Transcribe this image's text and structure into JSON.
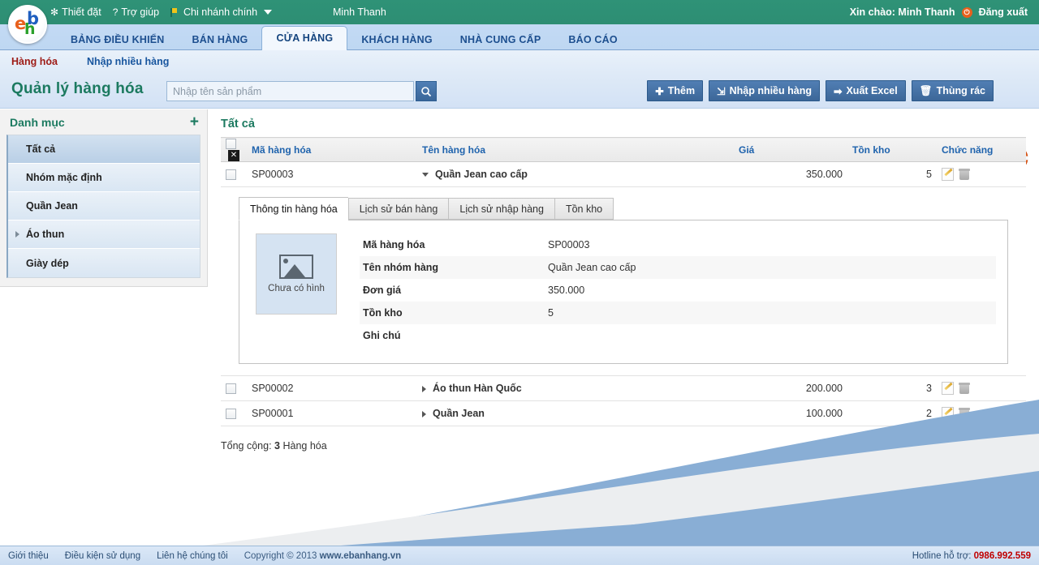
{
  "topbar": {
    "settings": "Thiết đặt",
    "settings_glyph": "✻",
    "help": "Trợ giúp",
    "help_glyph": "?",
    "branch": "Chi nhánh chính",
    "user_mid": "Minh Thanh",
    "greeting": "Xin chào: Minh Thanh",
    "logout": "Đăng xuất",
    "power_glyph": "⏻"
  },
  "logo": {
    "e": "e",
    "b": "b",
    "h": "h"
  },
  "nav": {
    "tabs": [
      {
        "label": "BẢNG ĐIỀU KHIỂN",
        "active": false
      },
      {
        "label": "BÁN HÀNG",
        "active": false
      },
      {
        "label": "CỬA HÀNG",
        "active": true
      },
      {
        "label": "KHÁCH HÀNG",
        "active": false
      },
      {
        "label": "NHÀ CUNG CẤP",
        "active": false
      },
      {
        "label": "BÁO CÁO",
        "active": false
      }
    ]
  },
  "subnav": {
    "items": [
      {
        "label": "Hàng hóa",
        "current": true
      },
      {
        "label": "Nhập nhiều hàng",
        "current": false
      }
    ]
  },
  "pagebar": {
    "title": "Quản lý hàng hóa",
    "search_placeholder": "Nhập tên sản phẩm",
    "search_value": "",
    "buttons": [
      {
        "icon": "✚",
        "label": "Thêm"
      },
      {
        "icon": "⇲",
        "label": "Nhập nhiều hàng"
      },
      {
        "icon": "➡",
        "label": "Xuất Excel"
      },
      {
        "icon": "🗑",
        "label": "Thùng rác"
      }
    ]
  },
  "sidebar": {
    "title": "Danh mục",
    "add_glyph": "+",
    "items": [
      {
        "label": "Tất cả",
        "active": true,
        "arrow": false
      },
      {
        "label": "Nhóm mặc định",
        "active": false,
        "arrow": false
      },
      {
        "label": "Quần Jean",
        "active": false,
        "arrow": false
      },
      {
        "label": "Áo thun",
        "active": false,
        "arrow": true
      },
      {
        "label": "Giày dép",
        "active": false,
        "arrow": false
      }
    ]
  },
  "main": {
    "heading": "Tất cả",
    "columns": {
      "code": "Mã hàng hóa",
      "name": "Tên hàng hóa",
      "price": "Giá",
      "stock": "Tồn kho",
      "fn": "Chức năng"
    },
    "rows": [
      {
        "code": "SP00003",
        "name": "Quần Jean cao cấp",
        "price": "350.000",
        "stock": "5",
        "expanded": true
      },
      {
        "code": "SP00002",
        "name": "Áo thun Hàn Quốc",
        "price": "200.000",
        "stock": "3",
        "expanded": false
      },
      {
        "code": "SP00001",
        "name": "Quần Jean",
        "price": "100.000",
        "stock": "2",
        "expanded": false
      }
    ],
    "total_label": "Tổng cộng:",
    "total_count": "3",
    "total_unit": "Hàng hóa"
  },
  "detail": {
    "tabs": [
      {
        "label": "Thông tin hàng hóa",
        "active": true
      },
      {
        "label": "Lịch sử bán hàng",
        "active": false
      },
      {
        "label": "Lịch sử nhập hàng",
        "active": false
      },
      {
        "label": "Tồn kho",
        "active": false
      }
    ],
    "thumb_label": "Chưa có hình",
    "fields": [
      {
        "label": "Mã hàng hóa",
        "value": "SP00003"
      },
      {
        "label": "Tên nhóm hàng",
        "value": "Quần Jean cao cấp"
      },
      {
        "label": "Đơn giá",
        "value": "350.000"
      },
      {
        "label": "Tồn kho",
        "value": "5"
      },
      {
        "label": "Ghi chú",
        "value": ""
      }
    ]
  },
  "footer": {
    "links": [
      "Giới thiệu",
      "Điều kiện sử dụng",
      "Liên hệ chúng tôi"
    ],
    "copyright_prefix": "Copyright © 2013",
    "copyright_site": "www.ebanhang.vn",
    "hotline_label": "Hotline hỗ trợ:",
    "hotline_number": "0986.992.559"
  },
  "colors": {
    "brand_green": "#2f9277",
    "nav_blue": "#c3daf4",
    "accent_blue": "#1f63ad",
    "hotline_red": "#c00000",
    "logo_orange": "#e8601c"
  }
}
